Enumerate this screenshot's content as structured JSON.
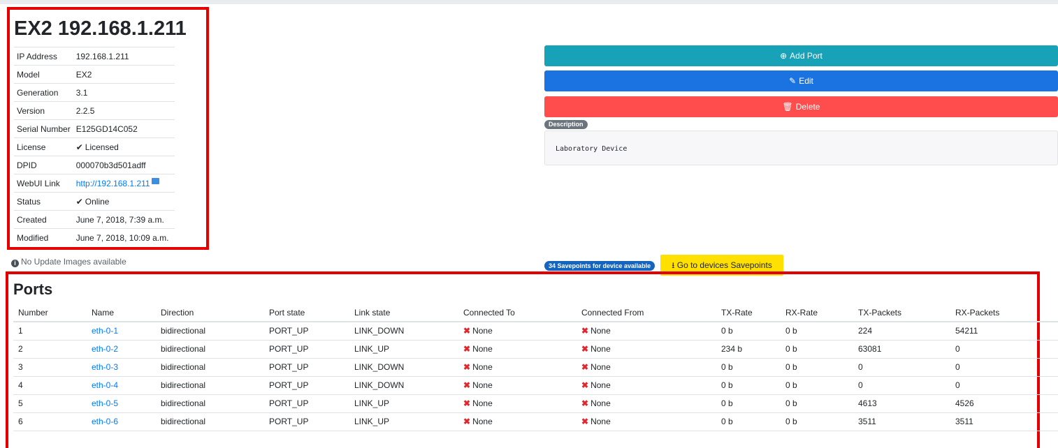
{
  "device": {
    "title": "EX2 192.168.1.211",
    "info": [
      {
        "key": "IP Address",
        "value": "192.168.1.211"
      },
      {
        "key": "Model",
        "value": "EX2"
      },
      {
        "key": "Generation",
        "value": "3.1"
      },
      {
        "key": "Version",
        "value": "2.2.5"
      },
      {
        "key": "Serial Number",
        "value": "E125GD14C052"
      },
      {
        "key": "License",
        "value": "Licensed"
      },
      {
        "key": "DPID",
        "value": "000070b3d501adff"
      },
      {
        "key": "WebUI Link",
        "value": "http://192.168.1.211"
      },
      {
        "key": "Status",
        "value": "Online"
      },
      {
        "key": "Created",
        "value": "June 7, 2018, 7:39 a.m."
      },
      {
        "key": "Modified",
        "value": "June 7, 2018, 10:09 a.m."
      }
    ],
    "no_update": "No Update Images available"
  },
  "actions": {
    "add_port": "Add Port",
    "edit": "Edit",
    "delete": "Delete"
  },
  "description": {
    "badge": "Description",
    "text": "Laboratory Device"
  },
  "savepoints": {
    "badge": "34 Savepoints for device available",
    "button": "Go to devices Savepoints"
  },
  "ports": {
    "title": "Ports",
    "columns": [
      "Number",
      "Name",
      "Direction",
      "Port state",
      "Link state",
      "Connected To",
      "Connected From",
      "TX-Rate",
      "RX-Rate",
      "TX-Packets",
      "RX-Packets"
    ],
    "rows": [
      {
        "number": "1",
        "name": "eth-0-1",
        "direction": "bidirectional",
        "port_state": "PORT_UP",
        "link_state": "LINK_DOWN",
        "connected_to": "None",
        "connected_from": "None",
        "tx_rate": "0 b",
        "rx_rate": "0 b",
        "tx_packets": "224",
        "rx_packets": "54211"
      },
      {
        "number": "2",
        "name": "eth-0-2",
        "direction": "bidirectional",
        "port_state": "PORT_UP",
        "link_state": "LINK_UP",
        "connected_to": "None",
        "connected_from": "None",
        "tx_rate": "234 b",
        "rx_rate": "0 b",
        "tx_packets": "63081",
        "rx_packets": "0"
      },
      {
        "number": "3",
        "name": "eth-0-3",
        "direction": "bidirectional",
        "port_state": "PORT_UP",
        "link_state": "LINK_DOWN",
        "connected_to": "None",
        "connected_from": "None",
        "tx_rate": "0 b",
        "rx_rate": "0 b",
        "tx_packets": "0",
        "rx_packets": "0"
      },
      {
        "number": "4",
        "name": "eth-0-4",
        "direction": "bidirectional",
        "port_state": "PORT_UP",
        "link_state": "LINK_DOWN",
        "connected_to": "None",
        "connected_from": "None",
        "tx_rate": "0 b",
        "rx_rate": "0 b",
        "tx_packets": "0",
        "rx_packets": "0"
      },
      {
        "number": "5",
        "name": "eth-0-5",
        "direction": "bidirectional",
        "port_state": "PORT_UP",
        "link_state": "LINK_UP",
        "connected_to": "None",
        "connected_from": "None",
        "tx_rate": "0 b",
        "rx_rate": "0 b",
        "tx_packets": "4613",
        "rx_packets": "4526"
      },
      {
        "number": "6",
        "name": "eth-0-6",
        "direction": "bidirectional",
        "port_state": "PORT_UP",
        "link_state": "LINK_UP",
        "connected_to": "None",
        "connected_from": "None",
        "tx_rate": "0 b",
        "rx_rate": "0 b",
        "tx_packets": "3511",
        "rx_packets": "3511"
      }
    ]
  },
  "colors": {
    "highlight": "#e50000",
    "add": "#17a2b8",
    "edit": "#1a73e0",
    "delete": "#ff4d4d",
    "savepoint_button": "#ffe000",
    "success": "#28a745",
    "danger": "#e0282e"
  }
}
